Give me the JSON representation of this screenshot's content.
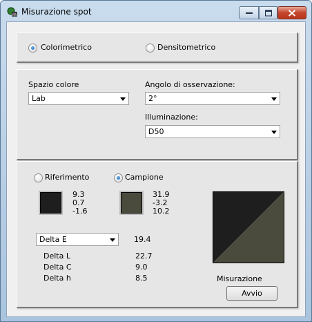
{
  "window": {
    "title": "Misurazione spot"
  },
  "mode": {
    "colorimetric_label": "Colorimetrico",
    "densitometric_label": "Densitometrico",
    "selected": "Colorimetrico"
  },
  "settings": {
    "color_space_label": "Spazio colore",
    "color_space_value": "Lab",
    "observer_label": "Angolo di osservazione:",
    "observer_value": "2°",
    "illuminant_label": "Illuminazione:",
    "illuminant_value": "D50"
  },
  "measurement": {
    "reference_label": "Riferimento",
    "sample_label": "Campione",
    "selected": "Campione",
    "reference_color": "#1e1e1e",
    "sample_color": "#4a4b3c",
    "reference_values": [
      "9.3",
      "0.7",
      "-1.6"
    ],
    "sample_values": [
      "31.9",
      "-3.2",
      "10.2"
    ],
    "delta_select_value": "Delta E",
    "delta_e": "19.4",
    "deltas": [
      {
        "label": "Delta L",
        "value": "22.7"
      },
      {
        "label": "Delta C",
        "value": "9.0"
      },
      {
        "label": "Delta h",
        "value": "8.5"
      }
    ],
    "measure_label": "Misurazione",
    "start_button": "Avvio"
  }
}
